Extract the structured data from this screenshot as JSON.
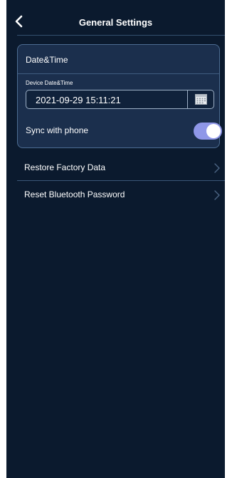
{
  "header": {
    "title": "General Settings",
    "back_icon": "chevron-left-icon"
  },
  "datetime_card": {
    "title": "Date&Time",
    "field_label": "Device Date&Time",
    "value": "2021-09-29 15:11:21",
    "calendar_icon": "calendar-icon",
    "sync_label": "Sync with phone",
    "sync_enabled": true
  },
  "menu": {
    "items": [
      {
        "label": "Restore Factory Data",
        "icon": "chevron-right-icon"
      },
      {
        "label": "Reset Bluetooth Password",
        "icon": "chevron-right-icon"
      }
    ]
  },
  "colors": {
    "background": "#0b1a2e",
    "card": "#1b2f4d",
    "toggle_on": "#8f97e8"
  }
}
